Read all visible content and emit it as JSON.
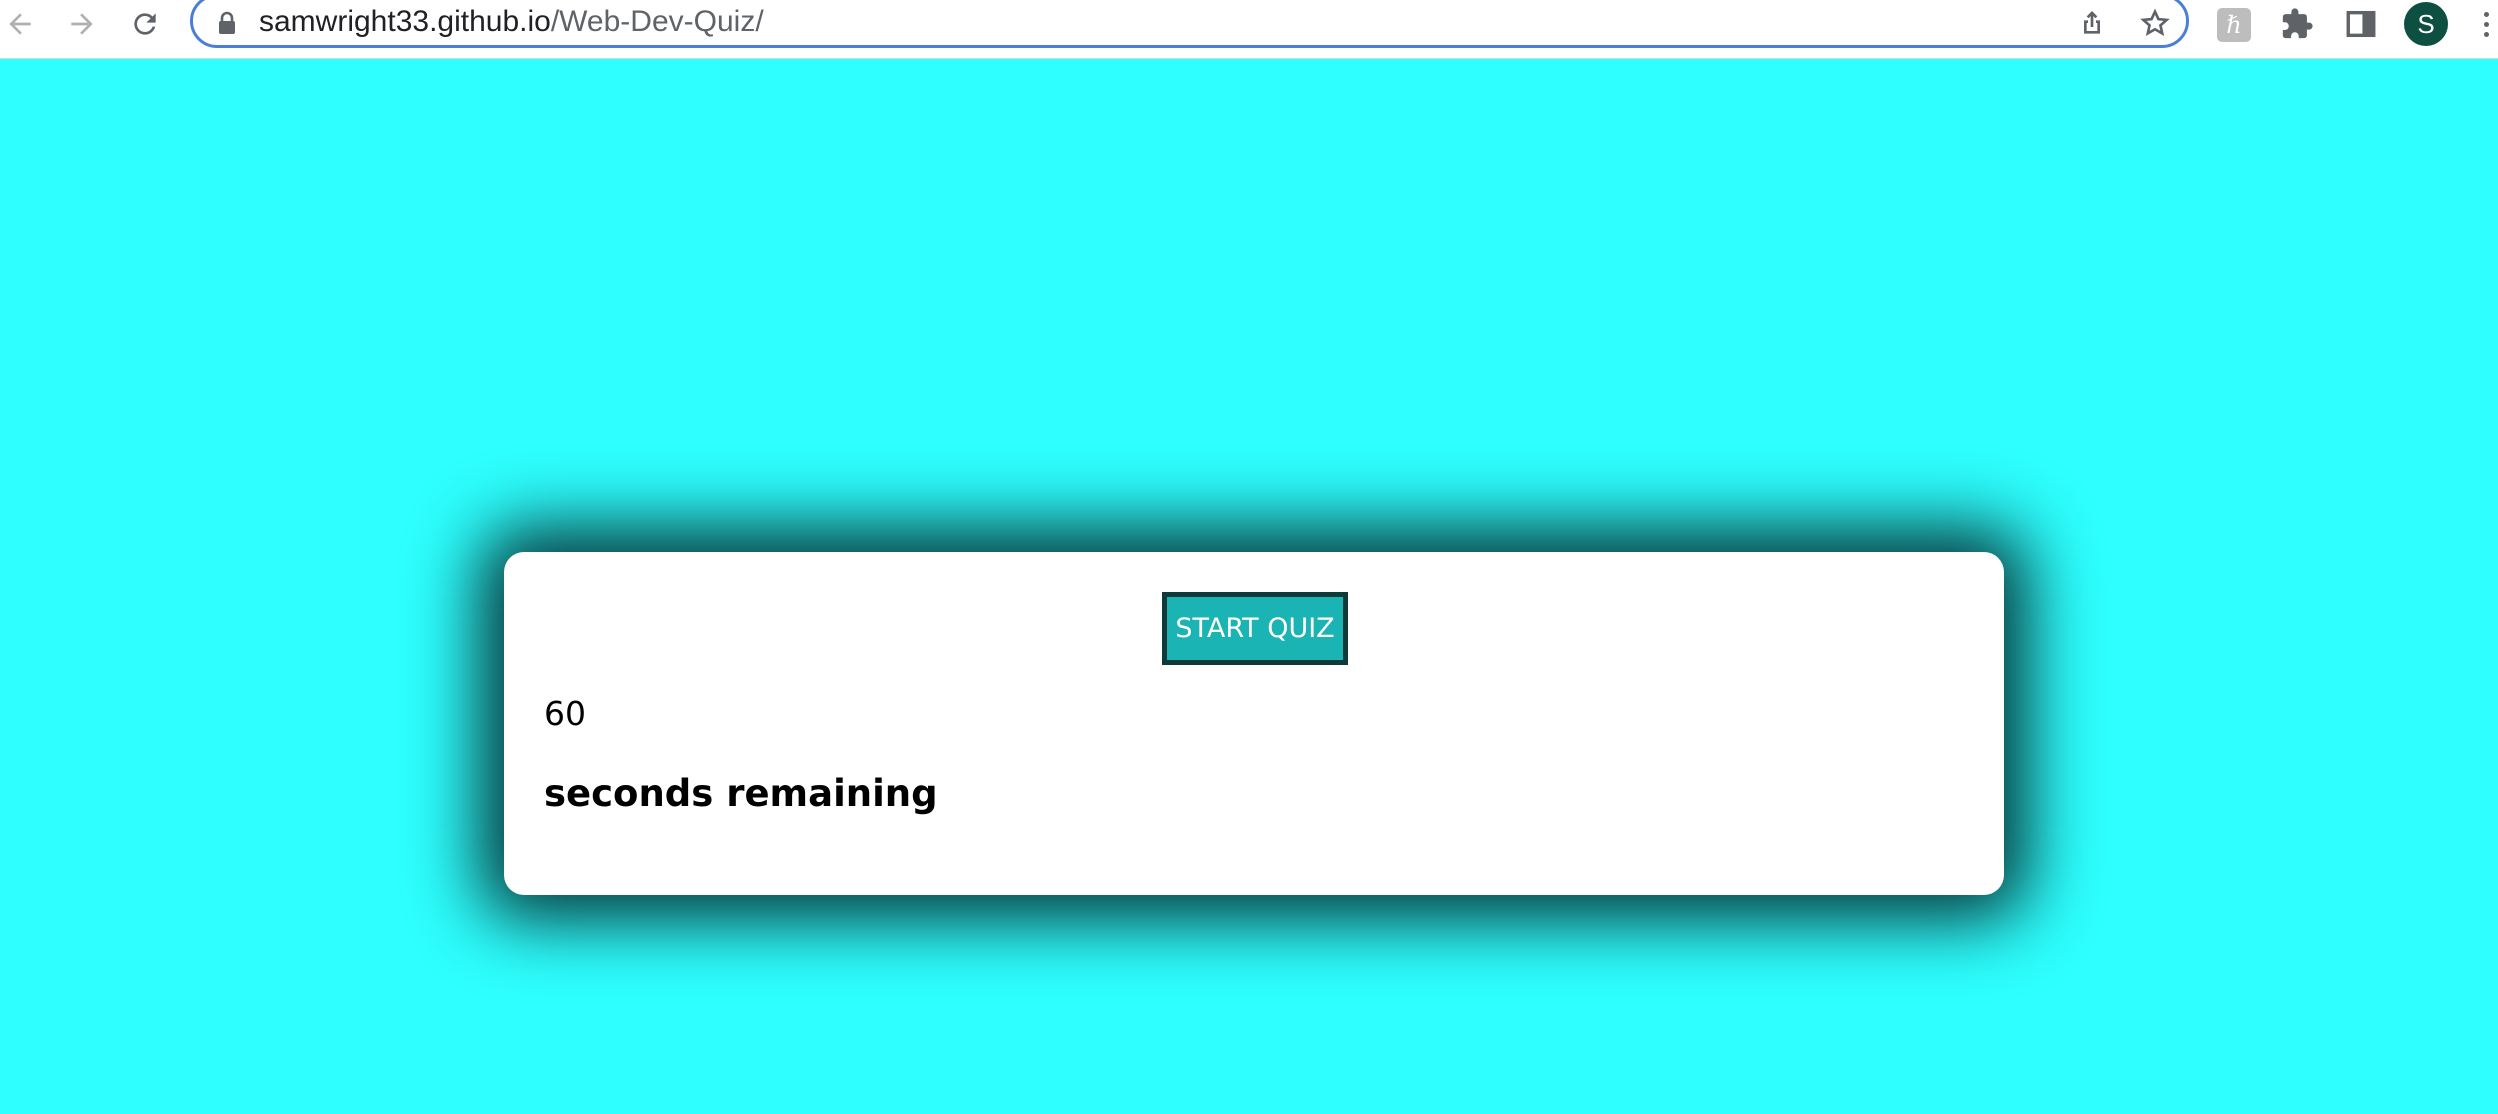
{
  "browser": {
    "url_host": "samwright33.github.io",
    "url_path": "/Web-Dev-Quiz/",
    "avatar_letter": "S",
    "accent_color": "#4a7fd8",
    "icons": [
      "back-arrow-icon",
      "forward-arrow-icon",
      "reload-icon",
      "lock-icon",
      "share-icon",
      "star-icon",
      "extension-h-icon",
      "puzzle-icon",
      "side-panel-icon",
      "menu-dots-icon"
    ]
  },
  "page": {
    "background_color": "#2effff",
    "start_button_label": "START QUIZ",
    "timer_value": "60",
    "timer_label": "seconds remaining",
    "button_color": "#1ab4b4"
  }
}
